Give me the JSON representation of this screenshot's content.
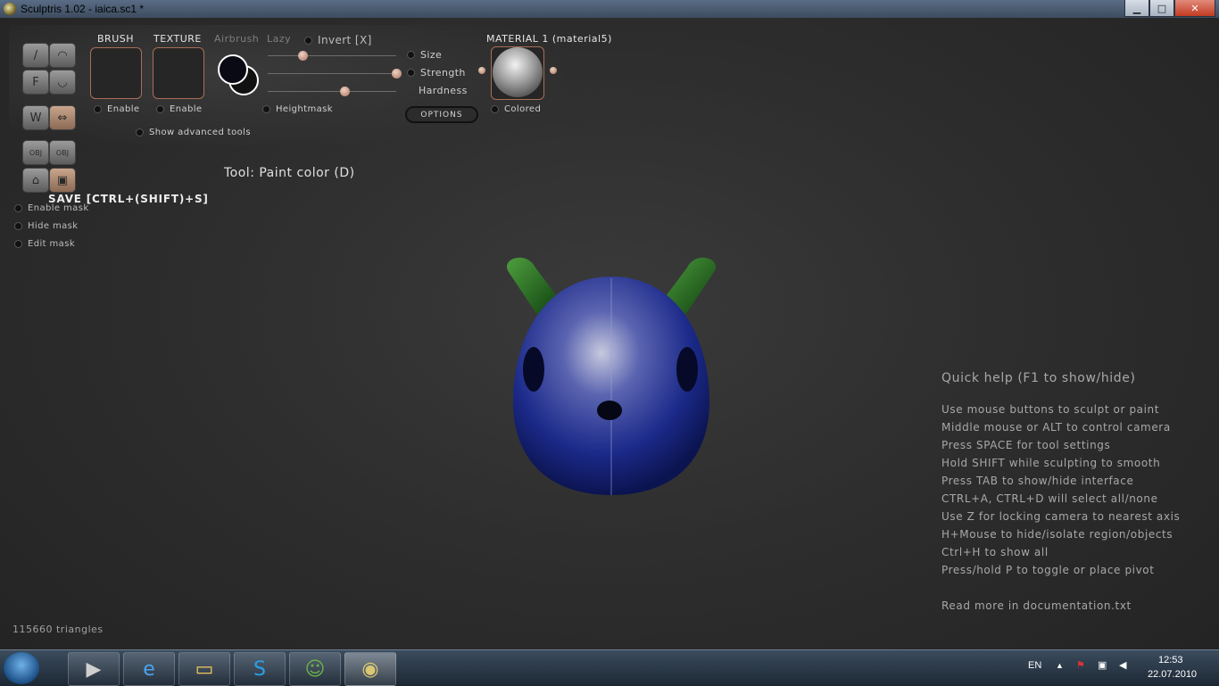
{
  "window": {
    "title": "Sculptris 1.02 - iaica.sc1 *",
    "minimize": "▁",
    "maximize": "□",
    "close": "✕"
  },
  "toolbar": {
    "brush_label": "BRUSH",
    "texture_label": "TEXTURE",
    "airbrush_label": "Airbrush",
    "lazy_label": "Lazy",
    "invert_label": "Invert [X]",
    "size_label": "Size",
    "strength_label": "Strength",
    "hardness_label": "Hardness",
    "brush_enable": "Enable",
    "texture_enable": "Enable",
    "heightmask_label": "Heightmask",
    "options_label": "OPTIONS",
    "material_label": "MATERIAL 1 (material5)",
    "colored_label": "Colored",
    "advanced_label": "Show advanced tools",
    "sliders": {
      "size": 0.27,
      "strength": 1.0,
      "hardness": 0.6
    }
  },
  "tool_status": "Tool: Paint color (D)",
  "save_hint": "SAVE [CTRL+(SHIFT)+S]",
  "mask_options": [
    "Enable mask",
    "Hide mask",
    "Edit mask"
  ],
  "quick_help": {
    "title": "Quick help (F1 to show/hide)",
    "lines": [
      "Use mouse buttons to sculpt or paint",
      "Middle mouse or ALT to control camera",
      "Press SPACE for tool settings",
      "Hold SHIFT while sculpting to smooth",
      "Press TAB to show/hide interface",
      "CTRL+A, CTRL+D will select all/none",
      "Use Z for locking camera to nearest axis",
      "H+Mouse to hide/isolate region/objects",
      "Ctrl+H to show all",
      "Press/hold P to toggle or place pivot",
      "",
      "Read more in documentation.txt"
    ]
  },
  "triangle_count": "115660 triangles",
  "taskbar": {
    "language": "EN",
    "time": "12:53",
    "date": "22.07.2010"
  }
}
